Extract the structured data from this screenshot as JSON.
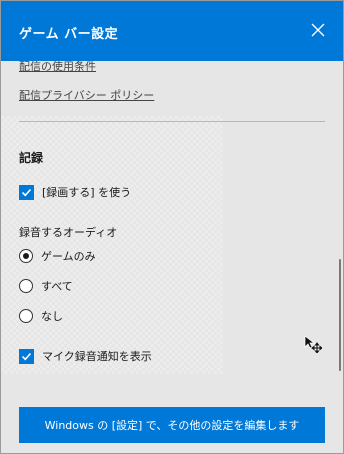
{
  "window": {
    "title": "ゲーム バー設定",
    "close_icon": "close-icon"
  },
  "links": {
    "terms": "配信の使用条件",
    "privacy": "配信プライバシー ポリシー"
  },
  "recording": {
    "section_title": "記録",
    "record_checkbox": {
      "label": "[録画する] を使う",
      "checked": true
    },
    "audio_title": "録音するオーディオ",
    "audio_options": [
      {
        "label": "ゲームのみ",
        "selected": true
      },
      {
        "label": "すべて",
        "selected": false
      },
      {
        "label": "なし",
        "selected": false
      }
    ],
    "mic_checkbox": {
      "label": "マイク録音通知を表示",
      "checked": true
    }
  },
  "footer": {
    "settings_button": "Windows の [設定] で、その他の設定を編集します"
  },
  "colors": {
    "accent": "#0078d7",
    "background": "#e6e6e6"
  }
}
